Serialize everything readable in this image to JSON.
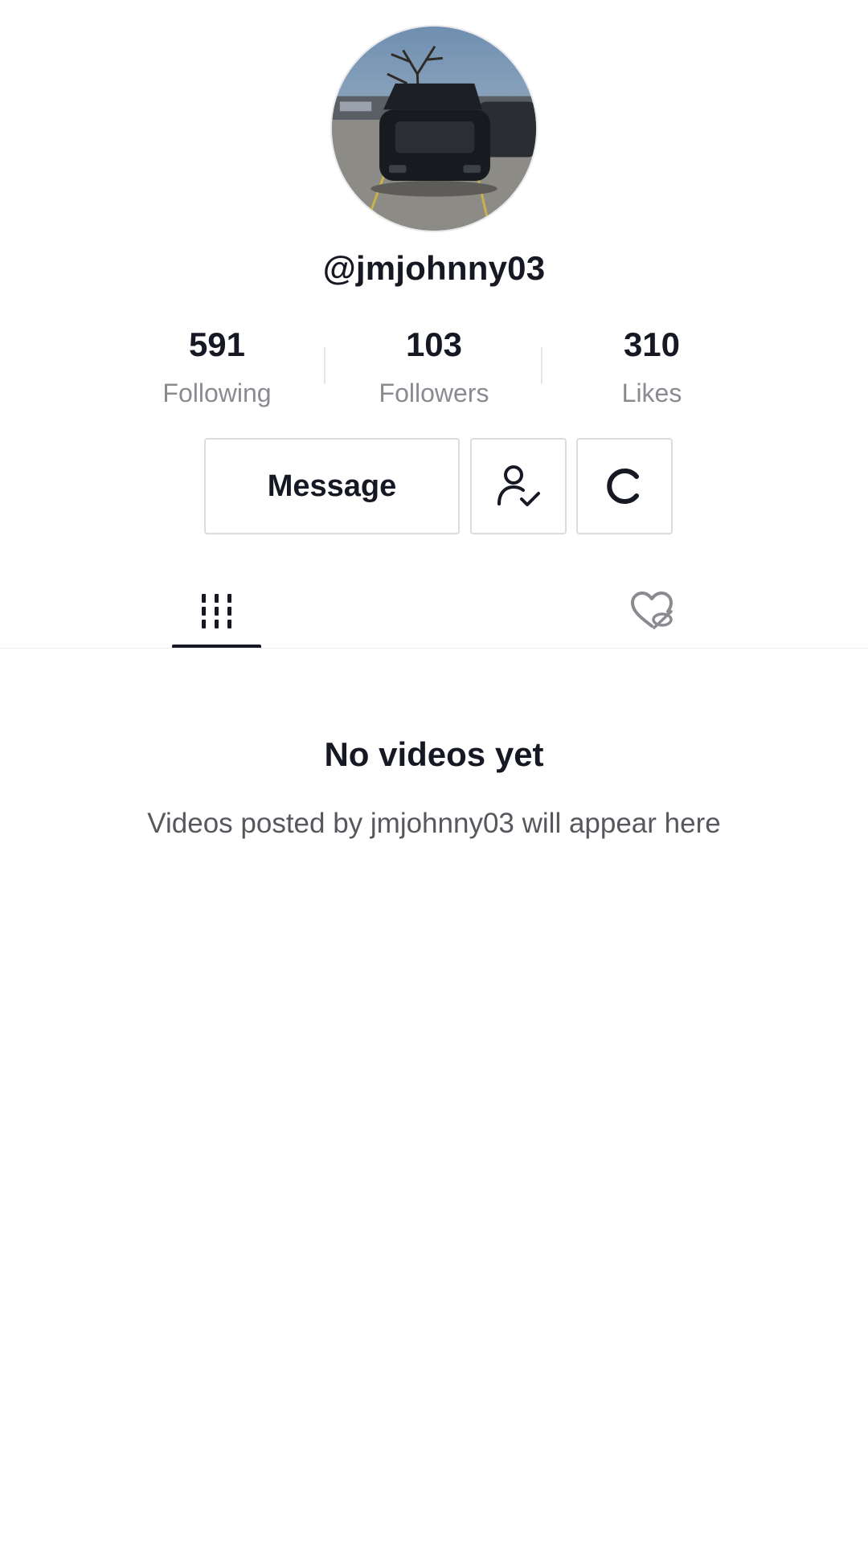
{
  "profile": {
    "username": "@jmjohnny03",
    "avatar_alt": "profile photo"
  },
  "stats": [
    {
      "value": "591",
      "label": "Following"
    },
    {
      "value": "103",
      "label": "Followers"
    },
    {
      "value": "310",
      "label": "Likes"
    }
  ],
  "actions": {
    "message_label": "Message",
    "friends_icon": "person-check-icon",
    "more_icon": "refresh-icon"
  },
  "tabs": [
    {
      "icon": "videos-grid-icon",
      "active": true
    },
    {
      "icon": "liked-hidden-icon",
      "active": false
    }
  ],
  "empty_state": {
    "title": "No videos yet",
    "subtitle": "Videos posted by jmjohnny03 will appear here"
  },
  "colors": {
    "text": "#161823",
    "muted": "#8a8b91",
    "border": "#dcdcdf"
  }
}
